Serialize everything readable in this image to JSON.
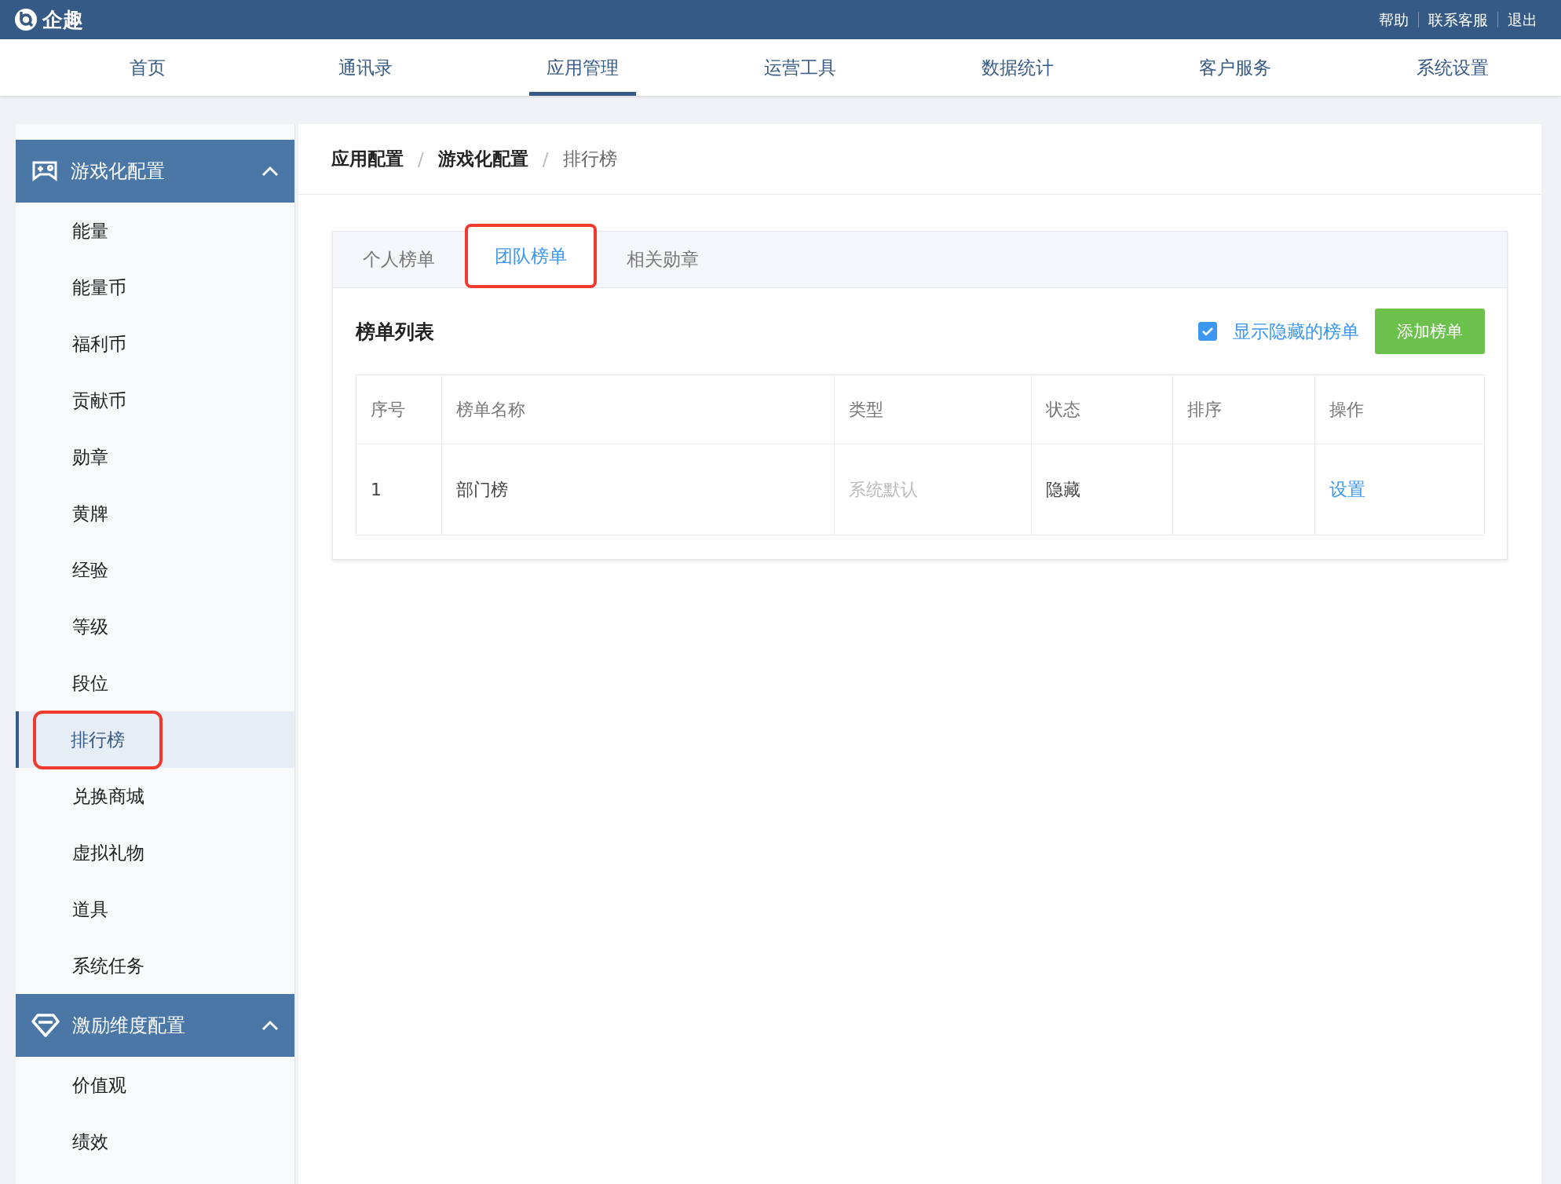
{
  "topbar": {
    "logo": "企趣",
    "links": [
      "帮助",
      "联系客服",
      "退出"
    ]
  },
  "nav": [
    {
      "label": "首页",
      "selected": false
    },
    {
      "label": "通讯录",
      "selected": false
    },
    {
      "label": "应用管理",
      "selected": true
    },
    {
      "label": "运营工具",
      "selected": false
    },
    {
      "label": "数据统计",
      "selected": false
    },
    {
      "label": "客户服务",
      "selected": false
    },
    {
      "label": "系统设置",
      "selected": false
    }
  ],
  "sidebar": [
    {
      "title": "游戏化配置",
      "expanded": true,
      "items": [
        {
          "label": "能量",
          "selected": false,
          "annotated": false
        },
        {
          "label": "能量币",
          "selected": false,
          "annotated": false
        },
        {
          "label": "福利币",
          "selected": false,
          "annotated": false
        },
        {
          "label": "贡献币",
          "selected": false,
          "annotated": false
        },
        {
          "label": "勋章",
          "selected": false,
          "annotated": false
        },
        {
          "label": "黄牌",
          "selected": false,
          "annotated": false
        },
        {
          "label": "经验",
          "selected": false,
          "annotated": false
        },
        {
          "label": "等级",
          "selected": false,
          "annotated": false
        },
        {
          "label": "段位",
          "selected": false,
          "annotated": false
        },
        {
          "label": "排行榜",
          "selected": true,
          "annotated": true
        },
        {
          "label": "兑换商城",
          "selected": false,
          "annotated": false
        },
        {
          "label": "虚拟礼物",
          "selected": false,
          "annotated": false
        },
        {
          "label": "道具",
          "selected": false,
          "annotated": false
        },
        {
          "label": "系统任务",
          "selected": false,
          "annotated": false
        }
      ]
    },
    {
      "title": "激励维度配置",
      "expanded": true,
      "items": [
        {
          "label": "价值观",
          "selected": false,
          "annotated": false
        },
        {
          "label": "绩效",
          "selected": false,
          "annotated": false
        }
      ]
    }
  ],
  "breadcrumb": [
    {
      "kind": "link",
      "text": "应用配置"
    },
    {
      "kind": "separator",
      "text": "/"
    },
    {
      "kind": "link",
      "text": "游戏化配置"
    },
    {
      "kind": "separator",
      "text": "/"
    },
    {
      "kind": "current",
      "text": "排行榜"
    }
  ],
  "tabs": [
    {
      "label": "个人榜单",
      "selected": false,
      "annotated": false
    },
    {
      "label": "团队榜单",
      "selected": true,
      "annotated": true
    },
    {
      "label": "相关勋章",
      "selected": false,
      "annotated": false
    }
  ],
  "list": {
    "title": "榜单列表",
    "show_hidden": {
      "label": "显示隐藏的榜单",
      "checked": true
    },
    "add_button": "添加榜单"
  },
  "table": {
    "columns": [
      "序号",
      "榜单名称",
      "类型",
      "状态",
      "排序",
      "操作"
    ],
    "rows": [
      {
        "index": "1",
        "name": "部门榜",
        "type": "系统默认",
        "status": "隐藏",
        "action": "设置"
      }
    ]
  }
}
